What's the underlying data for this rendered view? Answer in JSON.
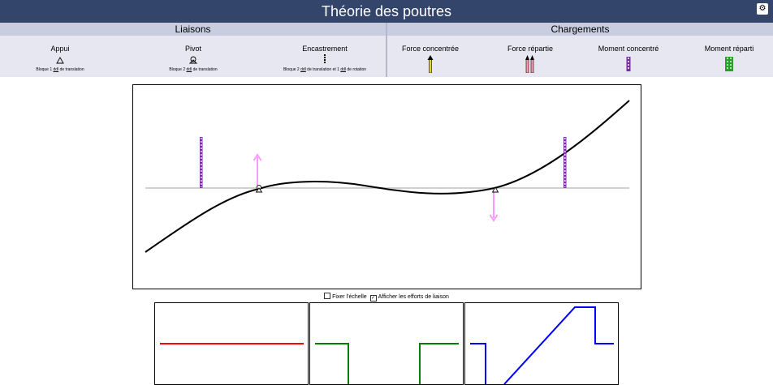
{
  "app": {
    "title": "Théorie des poutres",
    "settings_icon": "gear-icon"
  },
  "liaisons": {
    "header": "Liaisons",
    "items": [
      {
        "label": "Appui",
        "icon": "triangle-support-icon",
        "desc_pre": "Bloque 1 ",
        "desc_ddl": "ddl",
        "desc_post": " de translation"
      },
      {
        "label": "Pivot",
        "icon": "pivot-icon",
        "desc_pre": "Bloque 2 ",
        "desc_ddl": "ddl",
        "desc_post": " de translation"
      },
      {
        "label": "Encastrement",
        "icon": "encastrement-icon",
        "desc_pre": "Bloque 2 ",
        "desc_ddl": "ddl",
        "desc_mid": " de translation et 1 ",
        "desc_ddl2": "ddl",
        "desc_post": " de rotation"
      }
    ]
  },
  "chargements": {
    "header": "Chargements",
    "items": [
      {
        "label": "Force concentrée",
        "icon": "concentrated-force-icon",
        "color": "#e8d800"
      },
      {
        "label": "Force répartie",
        "icon": "distributed-force-icon",
        "color": "#ff9aaa"
      },
      {
        "label": "Moment concentré",
        "icon": "concentrated-moment-icon",
        "color": "#7a2ca8"
      },
      {
        "label": "Moment réparti",
        "icon": "distributed-moment-icon",
        "color": "#2aa02a"
      }
    ]
  },
  "options": {
    "fix_scale": {
      "label": "Fixer l'échelle",
      "checked": false
    },
    "show_efforts": {
      "label": "Afficher les efforts de liaison",
      "checked": true
    }
  },
  "colors": {
    "header_bg": "#33456a",
    "beam_axis": "#cccccc",
    "deformed_beam": "#000000",
    "reaction_arrow": "#ff99ff",
    "moment_marker": "#7a2ca8",
    "shear_curve": "#ff0000",
    "moment_curve": "#008000",
    "third_curve": "#0000ff"
  }
}
